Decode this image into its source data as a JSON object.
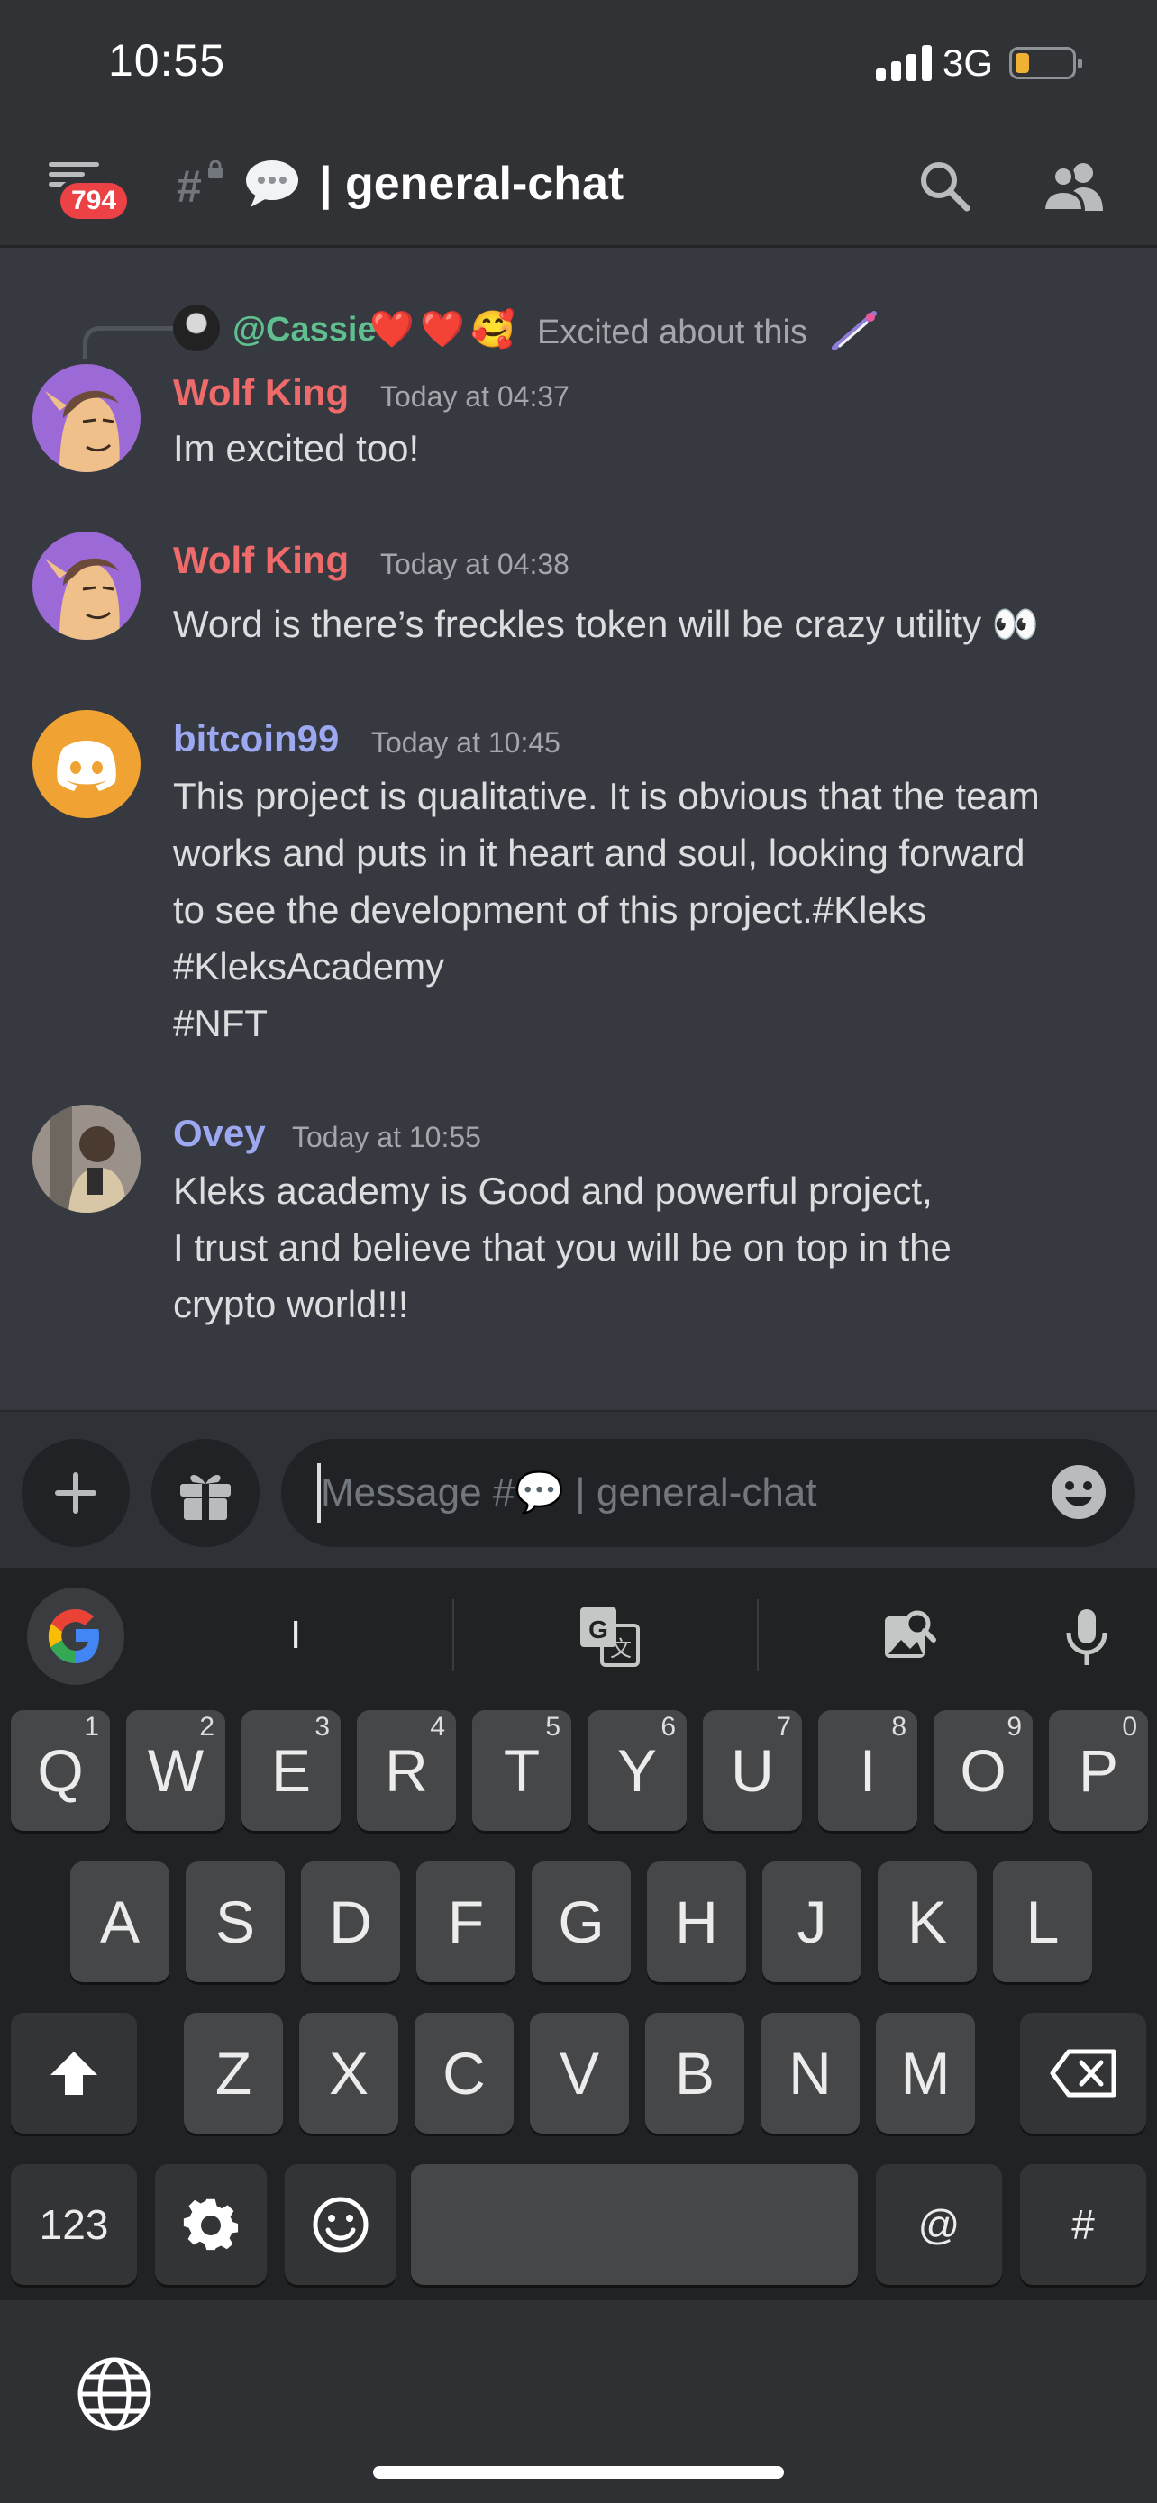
{
  "status_bar": {
    "time": "10:55",
    "network": "3G",
    "battery_level": 0.2
  },
  "header": {
    "unread_badge": "794",
    "channel_name": "| general-chat",
    "icons": [
      "menu-icon",
      "hash-lock-icon",
      "speech-bubble-icon",
      "search-icon",
      "members-icon"
    ]
  },
  "reply": {
    "mention": "@Cassie",
    "emojis": [
      "❤️",
      "❤️",
      "🥰"
    ],
    "preview_text": "Excited about this"
  },
  "messages": [
    {
      "author": "Wolf King",
      "timestamp": "Today at 04:37",
      "lines": [
        "Im excited too!"
      ]
    },
    {
      "author": "Wolf King",
      "timestamp": "Today at 04:38",
      "lines": [
        "Word is there’s freckles token will be crazy utility 👀"
      ]
    },
    {
      "author": "bitcoin99",
      "timestamp": "Today at 10:45",
      "lines": [
        "This project is qualitative. It is obvious that the team",
        "works and puts in it heart and soul, looking forward",
        "to see the development of this project.#Kleks",
        "#KleksAcademy",
        "#NFT"
      ]
    },
    {
      "author": "Ovey",
      "timestamp": "Today at 10:55",
      "lines": [
        "Kleks academy is Good and powerful project,",
        "I trust and believe that you will be on top in the",
        "crypto world!!!"
      ]
    }
  ],
  "composer": {
    "placeholder": "Message #💬 | general-chat"
  },
  "keyboard": {
    "suggestion": "I",
    "row1": [
      {
        "key": "Q",
        "hint": "1"
      },
      {
        "key": "W",
        "hint": "2"
      },
      {
        "key": "E",
        "hint": "3"
      },
      {
        "key": "R",
        "hint": "4"
      },
      {
        "key": "T",
        "hint": "5"
      },
      {
        "key": "Y",
        "hint": "6"
      },
      {
        "key": "U",
        "hint": "7"
      },
      {
        "key": "I",
        "hint": "8"
      },
      {
        "key": "O",
        "hint": "9"
      },
      {
        "key": "P",
        "hint": "0"
      }
    ],
    "row2": [
      "A",
      "S",
      "D",
      "F",
      "G",
      "H",
      "J",
      "K",
      "L"
    ],
    "row3": [
      "Z",
      "X",
      "C",
      "V",
      "B",
      "N",
      "M"
    ],
    "numbers_key": "123",
    "at_key": "@",
    "hash_key": "#"
  }
}
